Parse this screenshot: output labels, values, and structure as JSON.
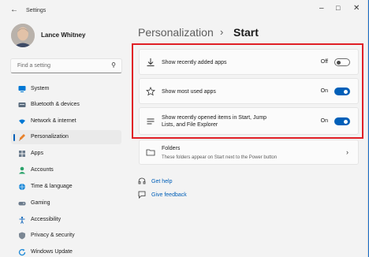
{
  "window": {
    "title": "Settings"
  },
  "user": {
    "name": "Lance Whitney"
  },
  "search": {
    "placeholder": "Find a setting"
  },
  "sidebar": {
    "items": [
      {
        "label": "System",
        "icon": "monitor-icon",
        "selected": false
      },
      {
        "label": "Bluetooth & devices",
        "icon": "bluetooth-icon",
        "selected": false
      },
      {
        "label": "Network & internet",
        "icon": "wifi-icon",
        "selected": false
      },
      {
        "label": "Personalization",
        "icon": "brush-icon",
        "selected": true
      },
      {
        "label": "Apps",
        "icon": "apps-icon",
        "selected": false
      },
      {
        "label": "Accounts",
        "icon": "person-icon",
        "selected": false
      },
      {
        "label": "Time & language",
        "icon": "globe-icon",
        "selected": false
      },
      {
        "label": "Gaming",
        "icon": "gamepad-icon",
        "selected": false
      },
      {
        "label": "Accessibility",
        "icon": "accessibility-icon",
        "selected": false
      },
      {
        "label": "Privacy & security",
        "icon": "shield-icon",
        "selected": false
      },
      {
        "label": "Windows Update",
        "icon": "update-icon",
        "selected": false
      }
    ]
  },
  "breadcrumb": {
    "parent": "Personalization",
    "separator": "›",
    "current": "Start"
  },
  "settings": [
    {
      "label": "Show recently added apps",
      "state": "Off",
      "on": false,
      "icon": "download-icon"
    },
    {
      "label": "Show most used apps",
      "state": "On",
      "on": true,
      "icon": "star-icon"
    },
    {
      "label": "Show recently opened items in Start, Jump Lists, and File Explorer",
      "state": "On",
      "on": true,
      "icon": "list-icon"
    }
  ],
  "folders": {
    "title": "Folders",
    "subtitle": "These folders appear on Start next to the Power button",
    "icon": "folder-icon"
  },
  "links": {
    "help": "Get help",
    "feedback": "Give feedback"
  },
  "colors": {
    "accent": "#005fb8",
    "highlight_border": "#e01f26"
  }
}
